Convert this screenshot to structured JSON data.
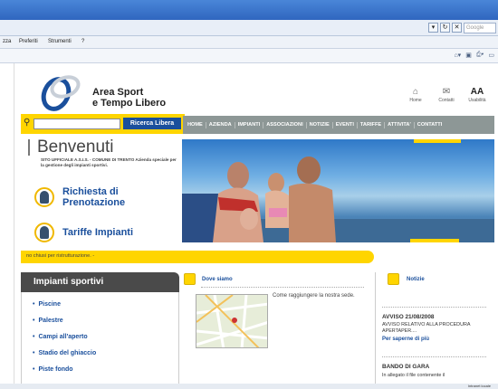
{
  "browser": {
    "menu": {
      "favorites": "Preferiti",
      "tools": "Strumenti",
      "help": "?",
      "partial": "zza"
    },
    "search_placeholder": "Google",
    "status_zone": "Intranet locale"
  },
  "header": {
    "logo_line1": "Area Sport",
    "logo_line2": "e Tempo Libero",
    "icons": [
      {
        "name": "home-icon",
        "glyph": "⌂",
        "label": "Home"
      },
      {
        "name": "contacts-icon",
        "glyph": "✉",
        "label": "Contatti"
      },
      {
        "name": "accessibility-icon",
        "glyph": "AA",
        "label": "Usabilità"
      }
    ]
  },
  "search": {
    "button": "Ricerca Libera"
  },
  "nav": [
    "HOME",
    "AZIENDA",
    "IMPIANTI",
    "ASSOCIAZIONI",
    "NOTIZIE",
    "EVENTI",
    "TARIFFE",
    "ATTIVITA'",
    "CONTATTI"
  ],
  "welcome": {
    "title": "Benvenuti",
    "subtitle": "SITO UFFICIALE A.S.I.S. - COMUNE DI TRENTO Azienda speciale per la gestione degli impianti sportivi."
  },
  "quick_links": {
    "booking_line1": "Richiesta di",
    "booking_line2": "Prenotazione",
    "fees": "Tariffe Impianti"
  },
  "ticker": "no chiusi per ristrutturazione. -",
  "sidebar": {
    "title": "Impianti sportivi",
    "items": [
      "Piscine",
      "Palestre",
      "Campi all'aperto",
      "Stadio del ghiaccio",
      "Piste fondo"
    ]
  },
  "where": {
    "title": "Dove siamo",
    "text": "Come raggiungere la nostra sede."
  },
  "news": {
    "title": "Notizie",
    "item1_title": "AVVISO 21/08/2008",
    "item1_text": "AVVISO RELATIVO ALLA PROCEDURA APERTAPER....",
    "item1_link": "Per saperne di più",
    "item2_title": "BANDO DI GARA",
    "item2_text": "In allegato il file contenente il"
  },
  "colors": {
    "accent": "#ffd500",
    "link": "#1a4f9c",
    "nav_bg": "#8d9796"
  }
}
